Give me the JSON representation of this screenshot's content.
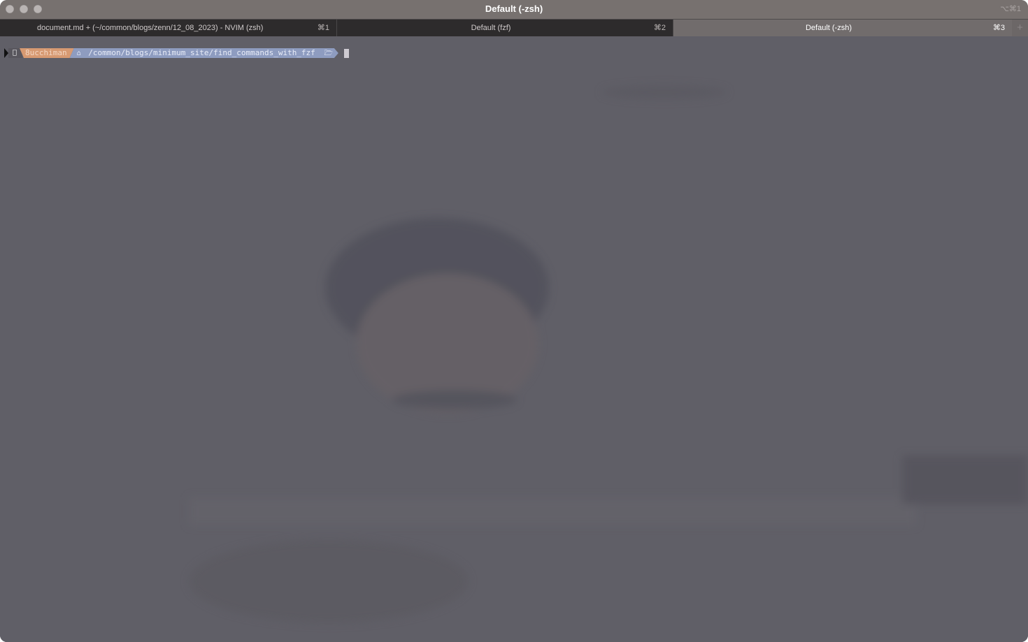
{
  "window": {
    "title": "Default (-zsh)",
    "shortcut": "⌥⌘1"
  },
  "tabs": [
    {
      "label": "document.md + (~/common/blogs/zenn/12_08_2023) - NVIM (zsh)",
      "shortcut": "⌘1",
      "active": false
    },
    {
      "label": "Default (fzf)",
      "shortcut": "⌘2",
      "active": false
    },
    {
      "label": "Default (-zsh)",
      "shortcut": "⌘3",
      "active": true
    }
  ],
  "tab_add": "+",
  "prompt": {
    "os_icon": "apple-icon",
    "user": "8ucchiman",
    "home_icon": "home-icon",
    "path": "/common/blogs/minimum_site/find_commands_with_fzf",
    "folder_icon": "folder-open-icon"
  },
  "colors": {
    "terminal_bg": "#605f67",
    "user_segment": "#d79a72",
    "path_segment": "#8e9cc0",
    "active_tab": "#716c6c"
  }
}
